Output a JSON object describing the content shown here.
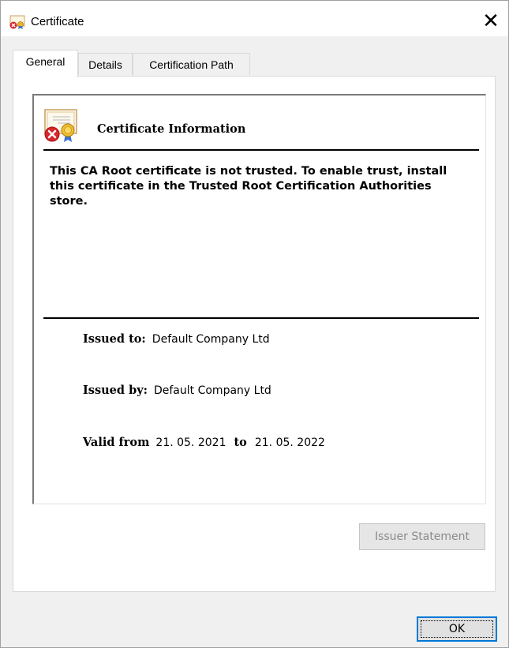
{
  "window": {
    "title": "Certificate",
    "close_glyph": "✕",
    "icon": "certificate-icon"
  },
  "tabs": [
    {
      "label": "General",
      "active": true
    },
    {
      "label": "Details",
      "active": false
    },
    {
      "label": "Certification Path",
      "active": false
    }
  ],
  "info": {
    "heading": "Certificate Information",
    "icon": "untrusted-certificate-icon",
    "warning": "This CA Root certificate is not trusted. To enable trust, install this certificate in the Trusted Root Certification Authorities store."
  },
  "fields": {
    "issued_to_label": "Issued to:",
    "issued_to_value": "Default Company Ltd",
    "issued_by_label": "Issued by:",
    "issued_by_value": "Default Company Ltd",
    "valid_from_label": "Valid from",
    "valid_from_value": "21. 05. 2021",
    "to_label": "to",
    "valid_to_value": "21. 05. 2022"
  },
  "buttons": {
    "issuer_statement": "Issuer Statement",
    "issuer_statement_enabled": false,
    "ok": "OK"
  },
  "colors": {
    "accent": "#0078d7",
    "error": "#d9252b"
  }
}
